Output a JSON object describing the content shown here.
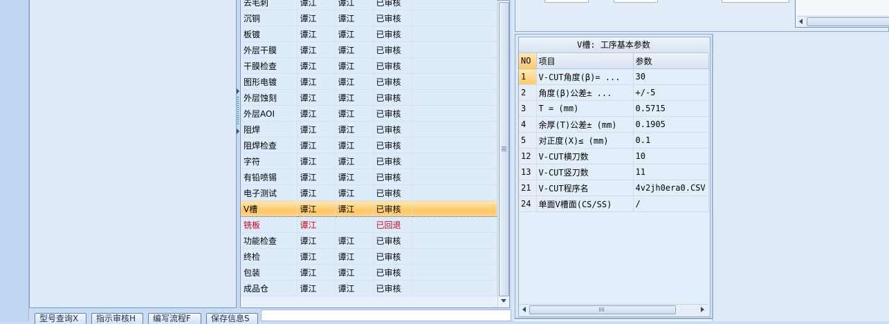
{
  "steps_table": {
    "rows": [
      {
        "step": "去毛刺",
        "operator": "谭江",
        "reviewer": "谭江",
        "status": "已审核",
        "state": "normal"
      },
      {
        "step": "沉铜",
        "operator": "谭江",
        "reviewer": "谭江",
        "status": "已审核",
        "state": "normal"
      },
      {
        "step": "板镀",
        "operator": "谭江",
        "reviewer": "谭江",
        "status": "已审核",
        "state": "normal"
      },
      {
        "step": "外层干膜",
        "operator": "谭江",
        "reviewer": "谭江",
        "status": "已审核",
        "state": "normal"
      },
      {
        "step": "干膜检查",
        "operator": "谭江",
        "reviewer": "谭江",
        "status": "已审核",
        "state": "normal"
      },
      {
        "step": "图形电镀",
        "operator": "谭江",
        "reviewer": "谭江",
        "status": "已审核",
        "state": "normal"
      },
      {
        "step": "外层蚀刻",
        "operator": "谭江",
        "reviewer": "谭江",
        "status": "已审核",
        "state": "normal"
      },
      {
        "step": "外层AOI",
        "operator": "谭江",
        "reviewer": "谭江",
        "status": "已审核",
        "state": "normal"
      },
      {
        "step": "阻焊",
        "operator": "谭江",
        "reviewer": "谭江",
        "status": "已审核",
        "state": "normal"
      },
      {
        "step": "阻焊检查",
        "operator": "谭江",
        "reviewer": "谭江",
        "status": "已审核",
        "state": "normal"
      },
      {
        "step": "字符",
        "operator": "谭江",
        "reviewer": "谭江",
        "status": "已审核",
        "state": "normal"
      },
      {
        "step": "有铅喷锡",
        "operator": "谭江",
        "reviewer": "谭江",
        "status": "已审核",
        "state": "normal"
      },
      {
        "step": "电子测试",
        "operator": "谭江",
        "reviewer": "谭江",
        "status": "已审核",
        "state": "normal"
      },
      {
        "step": "V槽",
        "operator": "谭江",
        "reviewer": "谭江",
        "status": "已审核",
        "state": "selected"
      },
      {
        "step": "铣板",
        "operator": "谭江",
        "reviewer": "",
        "status": "已回退",
        "state": "returned"
      },
      {
        "step": "功能检查",
        "operator": "谭江",
        "reviewer": "谭江",
        "status": "已审核",
        "state": "normal"
      },
      {
        "step": "终检",
        "operator": "谭江",
        "reviewer": "谭江",
        "status": "已审核",
        "state": "normal"
      },
      {
        "step": "包装",
        "operator": "谭江",
        "reviewer": "谭江",
        "status": "已审核",
        "state": "normal"
      },
      {
        "step": "成品仓",
        "operator": "谭江",
        "reviewer": "谭江",
        "status": "已审核",
        "state": "normal"
      }
    ]
  },
  "bottom_tabs": [
    {
      "label": "型号查询X"
    },
    {
      "label": "指示审核H"
    },
    {
      "label": "编写流程F"
    },
    {
      "label": "保存信息S"
    }
  ],
  "params": {
    "title": "V槽: 工序基本参数",
    "headers": {
      "no": "NO",
      "item": "项目",
      "value": "参数"
    },
    "rows": [
      {
        "no": "1",
        "item": "V-CUT角度(β)= ...",
        "value": "30"
      },
      {
        "no": "2",
        "item": "角度(β)公差± ...",
        "value": "+/-5"
      },
      {
        "no": "3",
        "item": "T = (mm)",
        "value": "0.5715"
      },
      {
        "no": "4",
        "item": "余厚(T)公差± (mm)",
        "value": "0.1905"
      },
      {
        "no": "5",
        "item": "对正度(X)≤ (mm)",
        "value": "0.1"
      },
      {
        "no": "12",
        "item": "V-CUT横刀数",
        "value": "10"
      },
      {
        "no": "13",
        "item": "V-CUT竖刀数",
        "value": "11"
      },
      {
        "no": "21",
        "item": "V-CUT程序名",
        "value": "4v2jh0era0.CSV"
      },
      {
        "no": "24",
        "item": "单面V槽面(CS/SS)",
        "value": "/"
      }
    ]
  },
  "colors": {
    "selected_row": "#ffc766",
    "returned_text": "#d0001c",
    "panel_bg": "#c9dcf3"
  },
  "icons": {
    "scroll_up": "triangle-up",
    "scroll_down": "triangle-down",
    "scroll_left": "triangle-left",
    "scroll_right": "triangle-right",
    "splitter_grip": "triangle-right"
  }
}
